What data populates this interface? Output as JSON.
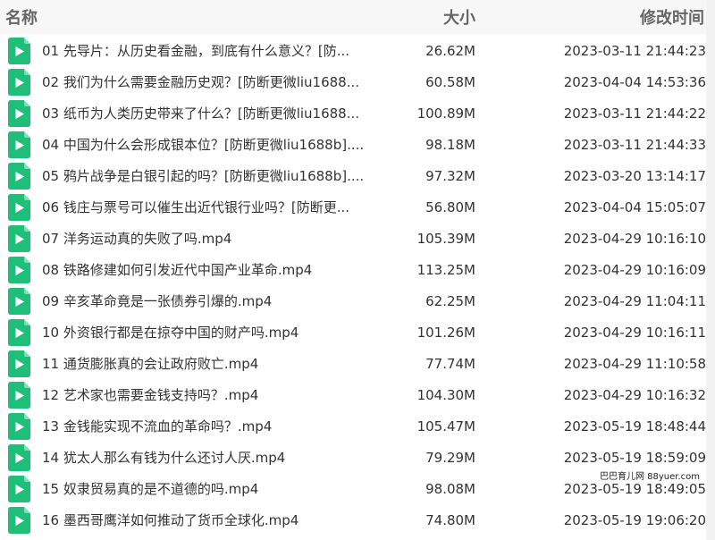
{
  "header": {
    "name": "名称",
    "size": "大小",
    "modified": "修改时间"
  },
  "colors": {
    "icon": "#1fbf7a",
    "text": "#333333",
    "header_text": "#666666"
  },
  "files": [
    {
      "name": "01 先导片：从历史看金融，到底有什么意义？[防...",
      "size": "26.62M",
      "modified": "2023-03-11 21:44:23"
    },
    {
      "name": "02 我们为什么需要金融历史观？[防断更微liu1688...",
      "size": "60.58M",
      "modified": "2023-04-04 14:53:36"
    },
    {
      "name": "03 纸币为人类历史带来了什么？[防断更微liu1688...",
      "size": "100.89M",
      "modified": "2023-03-11 21:44:22"
    },
    {
      "name": "04 中国为什么会形成银本位？[防断更微liu1688b]....",
      "size": "98.18M",
      "modified": "2023-03-11 21:44:33"
    },
    {
      "name": "05 鸦片战争是白银引起的吗？[防断更微liu1688b]....",
      "size": "97.32M",
      "modified": "2023-03-20 13:14:17"
    },
    {
      "name": "06 钱庄与票号可以催生出近代银行业吗？[防断更...",
      "size": "56.80M",
      "modified": "2023-04-04 15:05:07"
    },
    {
      "name": "07 洋务运动真的失败了吗.mp4",
      "size": "105.39M",
      "modified": "2023-04-29 10:16:10"
    },
    {
      "name": "08 铁路修建如何引发近代中国产业革命.mp4",
      "size": "113.25M",
      "modified": "2023-04-29 10:16:09"
    },
    {
      "name": "09 辛亥革命竟是一张债券引爆的.mp4",
      "size": "62.25M",
      "modified": "2023-04-29 11:04:11"
    },
    {
      "name": "10 外资银行都是在掠夺中国的财产吗.mp4",
      "size": "101.26M",
      "modified": "2023-04-29 10:16:11"
    },
    {
      "name": "11 通货膨胀真的会让政府败亡.mp4",
      "size": "77.74M",
      "modified": "2023-04-29 11:10:58"
    },
    {
      "name": "12 艺术家也需要金钱支持吗？.mp4",
      "size": "104.30M",
      "modified": "2023-04-29 10:16:32"
    },
    {
      "name": "13 金钱能实现不流血的革命吗？.mp4",
      "size": "105.47M",
      "modified": "2023-05-19 18:48:44"
    },
    {
      "name": "14 犹太人那么有钱为什么还讨人厌.mp4",
      "size": "79.29M",
      "modified": "2023-05-19 18:59:09"
    },
    {
      "name": "15 奴隶贸易真的是不道德的吗.mp4",
      "size": "98.08M",
      "modified": "2023-05-19 18:49:05"
    },
    {
      "name": "16 墨西哥鹰洋如何推动了货币全球化.mp4",
      "size": "74.80M",
      "modified": "2023-05-19 19:06:20"
    }
  ],
  "icon_name": "video-file-icon",
  "watermark": "巴巴育儿网 88yuer.com"
}
